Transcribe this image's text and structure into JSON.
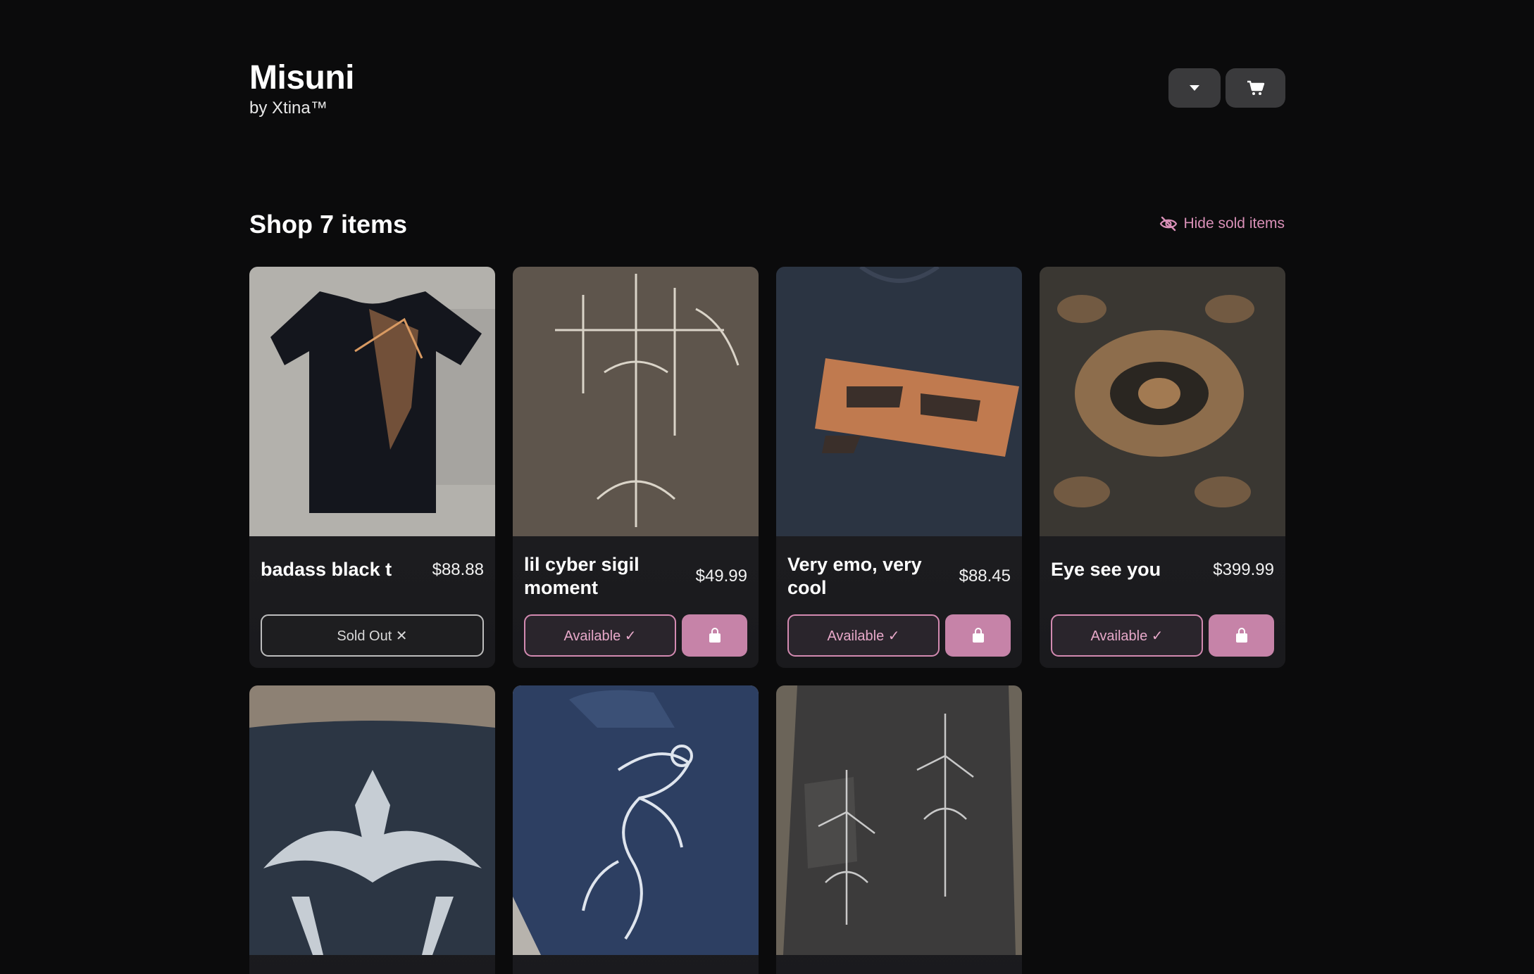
{
  "brand": {
    "title": "Misuni",
    "subtitle": "by Xtina™"
  },
  "header": {
    "menu_icon": "caret-down-icon",
    "cart_icon": "cart-icon"
  },
  "shop": {
    "title": "Shop 7 items",
    "hide_sold_label": "Hide sold items",
    "hide_sold_icon": "eye-slash-icon"
  },
  "colors": {
    "background": "#0b0b0c",
    "accent": "#c683a8",
    "accent_text": "#d990b8"
  },
  "products": [
    {
      "name": "badass black t",
      "price": "$88.88",
      "status": "Sold Out ✕",
      "sold": true
    },
    {
      "name": "lil cyber sigil moment",
      "price": "$49.99",
      "status": "Available ✓",
      "sold": false
    },
    {
      "name": "Very emo, very cool",
      "price": "$88.45",
      "status": "Available ✓",
      "sold": false
    },
    {
      "name": "Eye see you",
      "price": "$399.99",
      "status": "Available ✓",
      "sold": false
    },
    {
      "name": "",
      "price": "",
      "status": "",
      "sold": false
    },
    {
      "name": "",
      "price": "",
      "status": "",
      "sold": false
    },
    {
      "name": "",
      "price": "",
      "status": "",
      "sold": false
    }
  ]
}
